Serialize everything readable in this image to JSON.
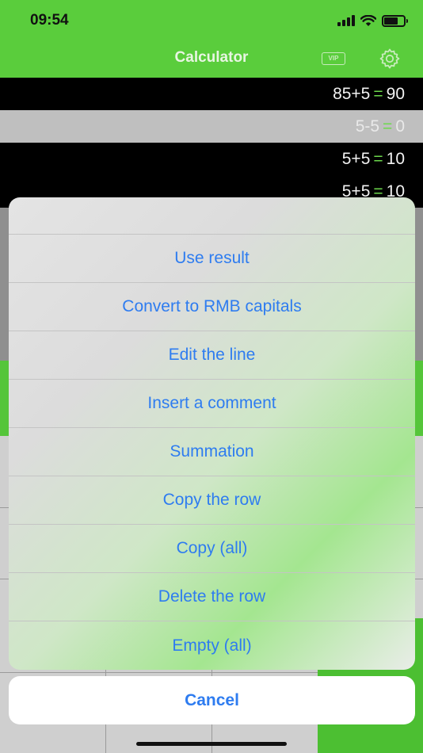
{
  "status": {
    "time": "09:54"
  },
  "nav": {
    "title": "Calculator",
    "vip_label": "VIP"
  },
  "history": [
    {
      "expr": "85+5",
      "eq": "=",
      "result": "90"
    },
    {
      "expr": "5-5",
      "eq": "=",
      "result": "0"
    },
    {
      "expr": "5+5",
      "eq": "=",
      "result": "10"
    },
    {
      "expr": "5+5",
      "eq": "=",
      "result": "10"
    }
  ],
  "action_sheet": {
    "items": [
      "Use result",
      "Convert to RMB capitals",
      "Edit the line",
      "Insert a comment",
      "Summation",
      "Copy the row",
      "Copy (all)",
      "Delete the row",
      "Empty (all)"
    ],
    "cancel_label": "Cancel"
  },
  "colors": {
    "brand_green": "#5acd3c",
    "action_blue": "#2e7cf0",
    "equals_green": "#6cd84c"
  }
}
